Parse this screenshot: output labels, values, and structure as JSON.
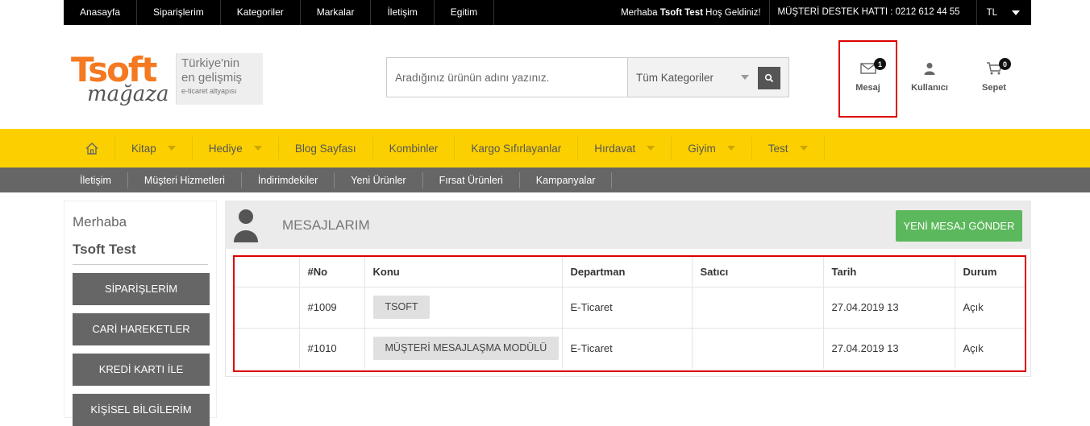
{
  "topbar": {
    "nav": [
      "Anasayfa",
      "Siparişlerim",
      "Kategoriler",
      "Markalar",
      "İletişim",
      "Egitim"
    ],
    "greeting_prefix": "Merhaba ",
    "greeting_name": "Tsoft Test",
    "greeting_suffix": " Hoş Geldiniz!",
    "support": "MÜŞTERİ DESTEK HATTI : 0212 612 44 55",
    "currency": "TL"
  },
  "logo": {
    "brand": "Tsoft",
    "sub": "mağaza",
    "tagline1": "Türkiye'nin",
    "tagline2": "en gelişmiş",
    "tagline3": "e-ticaret altyapısı"
  },
  "search": {
    "placeholder": "Aradığınız ürünün adını yazınız.",
    "category": "Tüm Kategoriler"
  },
  "header_icons": {
    "message": {
      "label": "Mesaj",
      "count": "1",
      "icon": "envelope-icon"
    },
    "user": {
      "label": "Kullanıcı",
      "icon": "user-icon"
    },
    "cart": {
      "label": "Sepet",
      "count": "0",
      "icon": "cart-icon"
    }
  },
  "main_nav": [
    "Kitap",
    "Hediye",
    "Blog Sayfası",
    "Kombinler",
    "Kargo Sıfırlayanlar",
    "Hırdavat",
    "Giyim",
    "Test"
  ],
  "sub_nav": [
    "İletişim",
    "Müşteri Hizmetleri",
    "İndirimdekiler",
    "Yeni Ürünler",
    "Fırsat Ürünleri",
    "Kampanyalar"
  ],
  "sidebar": {
    "hello": "Merhaba",
    "user": "Tsoft Test",
    "buttons": [
      "SİPARİŞLERİM",
      "CARİ HAREKETLER",
      "KREDİ KARTI İLE",
      "KİŞİSEL BİLGİLERİM"
    ]
  },
  "messages": {
    "title": "MESAJLARIM",
    "new_button": "YENİ MESAJ GÖNDER",
    "columns": [
      "",
      "#No",
      "Konu",
      "Departman",
      "Satıcı",
      "Tarih",
      "Durum"
    ],
    "rows": [
      {
        "no": "#1009",
        "subject": "TSOFT",
        "department": "E-Ticaret",
        "seller": "",
        "date": "27.04.2019 13",
        "status": "Açık"
      },
      {
        "no": "#1010",
        "subject": "MÜŞTERİ MESAJLAŞMA MODÜLÜ",
        "department": "E-Ticaret",
        "seller": "",
        "date": "27.04.2019 13",
        "status": "Açık"
      }
    ]
  },
  "colors": {
    "accent": "#fcd000",
    "logo_orange": "#f47920",
    "success": "#5cb85c",
    "highlight": "#dd0000"
  }
}
